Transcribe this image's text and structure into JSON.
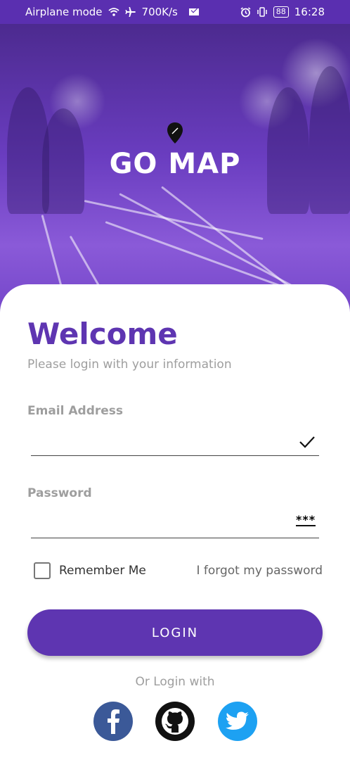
{
  "status_bar": {
    "left_text": "Airplane mode",
    "speed": "700K/s",
    "battery": "88",
    "time": "16:28"
  },
  "brand": {
    "title": "GO MAP",
    "icon": "map-pin-icon"
  },
  "login": {
    "welcome": "Welcome",
    "subtitle": "Please login with your information",
    "email_label": "Email Address",
    "email_value": "",
    "password_label": "Password",
    "password_value": "",
    "password_toggle": "***",
    "remember_label": "Remember Me",
    "remember_checked": false,
    "forgot_label": "I forgot my password",
    "login_button": "LOGIN",
    "or_login_with": "Or Login with"
  },
  "social": [
    {
      "name": "facebook",
      "icon": "facebook-icon",
      "color": "#3b5998"
    },
    {
      "name": "github",
      "icon": "github-icon",
      "color": "#111111"
    },
    {
      "name": "twitter",
      "icon": "twitter-icon",
      "color": "#1da1f2"
    }
  ],
  "colors": {
    "accent": "#5e35b1",
    "status_bar": "#5a2fb0"
  }
}
